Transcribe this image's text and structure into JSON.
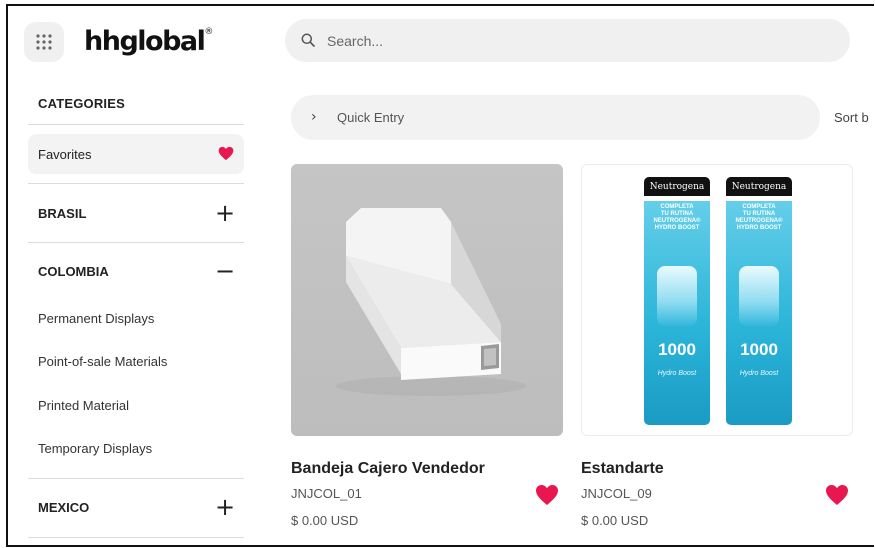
{
  "header": {
    "logo_text": "hhglobal",
    "logo_mark": "®",
    "apps_icon": "grid-dots-icon",
    "search_placeholder": "Search..."
  },
  "sidebar": {
    "title": "CATEGORIES",
    "favorites_label": "Favorites",
    "sections": [
      {
        "label": "BRASIL",
        "toggle": "+",
        "expanded": false
      },
      {
        "label": "COLOMBIA",
        "toggle": "−",
        "expanded": true,
        "items": [
          "Permanent Displays",
          "Point-of-sale Materials",
          "Printed Material",
          "Temporary Displays"
        ]
      },
      {
        "label": "MEXICO",
        "toggle": "+",
        "expanded": false
      }
    ]
  },
  "toolbar": {
    "quick_entry_label": "Quick Entry",
    "sort_label": "Sort b"
  },
  "products": [
    {
      "name": "Bandeja Cajero Vendedor",
      "sku": "JNJCOL_01",
      "price": "$ 0.00 USD",
      "favorite": true
    },
    {
      "name": "Estandarte",
      "sku": "JNJCOL_09",
      "price": "$ 0.00 USD",
      "favorite": true,
      "banner_text": {
        "brand": "Neutrogena",
        "line1": "COMPLETA",
        "line2": "TU RUTINA",
        "line3": "NEUTROGENA®",
        "line4": "HYDRO BOOST",
        "number": "1000",
        "footer": "Hydro Boost"
      }
    }
  ],
  "colors": {
    "heart": "#e8174f",
    "panel_bg": "#f2f2f2",
    "banner_blue": "#2bb5d9"
  }
}
